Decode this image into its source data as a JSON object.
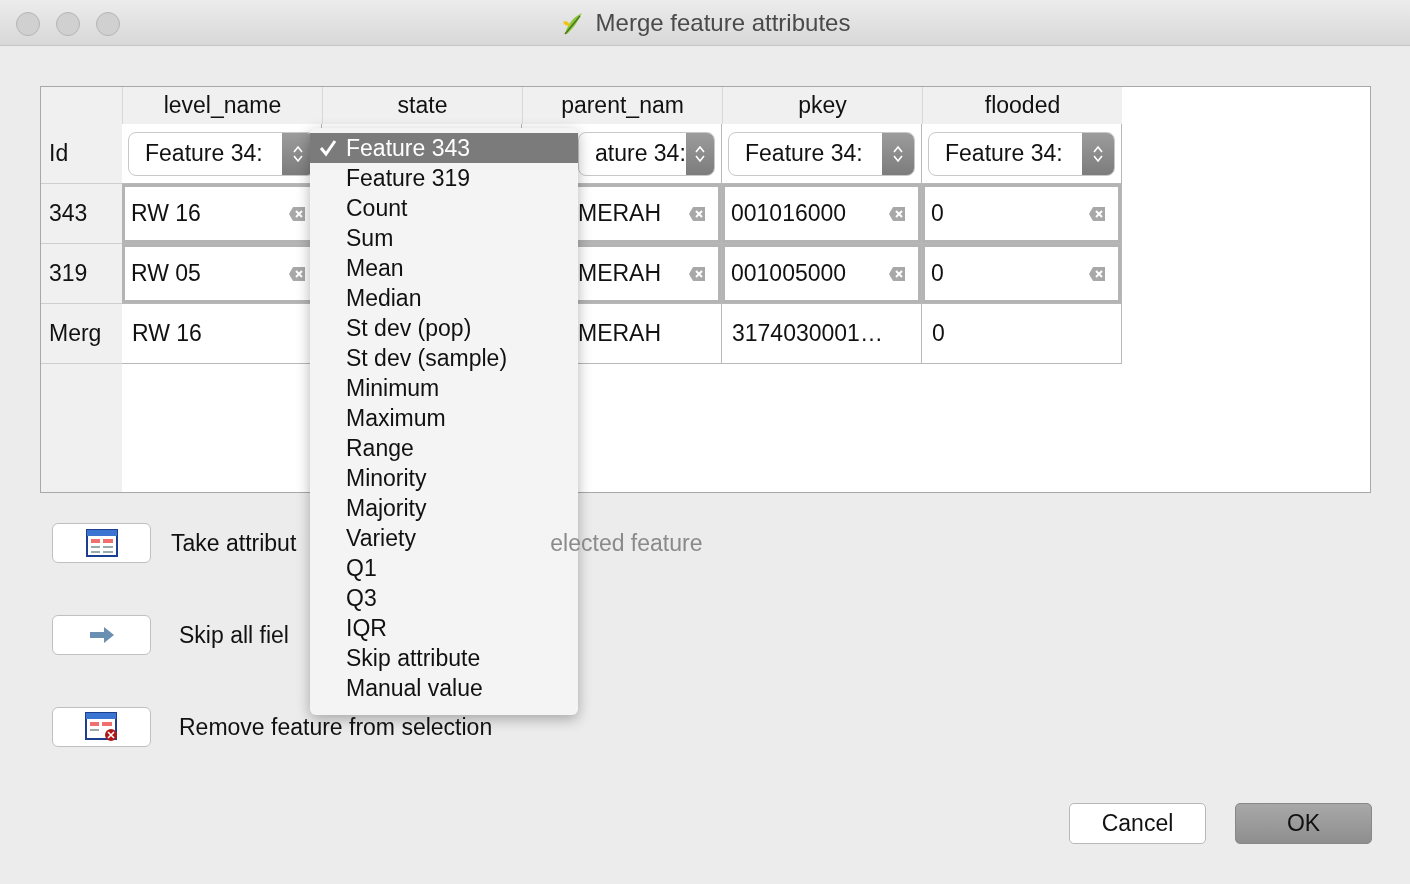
{
  "window": {
    "title": "Merge feature attributes"
  },
  "table": {
    "columns": [
      "level_name",
      "state",
      "parent_nam",
      "pkey",
      "flooded"
    ],
    "rows": [
      {
        "header": "Id",
        "kind": "combo",
        "cells": [
          "Feature 34:",
          null,
          "ature 34:",
          "Feature 34:",
          "Feature 34:"
        ]
      },
      {
        "header": "343",
        "kind": "edit",
        "cells": [
          "RW 16",
          null,
          "MERAH",
          "001016000",
          "0"
        ]
      },
      {
        "header": "319",
        "kind": "edit",
        "cells": [
          "RW 05",
          null,
          "MERAH",
          "001005000",
          "0"
        ]
      },
      {
        "header": "Merg",
        "kind": "plain",
        "cells": [
          "RW 16",
          null,
          "MERAH",
          "3174030001…",
          "0"
        ]
      }
    ]
  },
  "popup": {
    "items": [
      {
        "label": "Feature 343",
        "selected": true
      },
      {
        "label": "Feature 319",
        "selected": false
      },
      {
        "label": "Count",
        "selected": false
      },
      {
        "label": "Sum",
        "selected": false
      },
      {
        "label": "Mean",
        "selected": false
      },
      {
        "label": "Median",
        "selected": false
      },
      {
        "label": "St dev (pop)",
        "selected": false
      },
      {
        "label": "St dev (sample)",
        "selected": false
      },
      {
        "label": "Minimum",
        "selected": false
      },
      {
        "label": "Maximum",
        "selected": false
      },
      {
        "label": "Range",
        "selected": false
      },
      {
        "label": "Minority",
        "selected": false
      },
      {
        "label": "Majority",
        "selected": false
      },
      {
        "label": "Variety",
        "selected": false
      },
      {
        "label": "Q1",
        "selected": false
      },
      {
        "label": "Q3",
        "selected": false
      },
      {
        "label": "IQR",
        "selected": false
      },
      {
        "label": "Skip attribute",
        "selected": false
      },
      {
        "label": "Manual value",
        "selected": false
      }
    ]
  },
  "actions": [
    {
      "kind": "table",
      "label": "Take attribut",
      "faded": "elected feature"
    },
    {
      "kind": "arrow",
      "label": "Skip all fiel"
    },
    {
      "kind": "remove",
      "label": "Remove feature from selection"
    }
  ],
  "buttons": [
    {
      "label": "Cancel",
      "default": false
    },
    {
      "label": "OK",
      "default": true
    }
  ]
}
